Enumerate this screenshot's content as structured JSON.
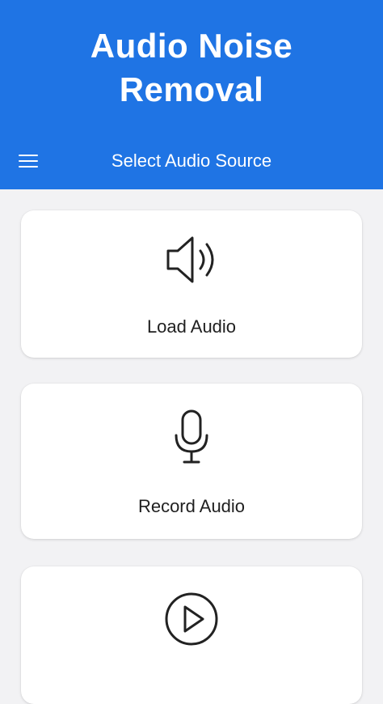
{
  "header": {
    "title": "Audio Noise\nRemoval",
    "toolbar_title": "Select Audio Source",
    "menu_icon": "hamburger-menu-icon",
    "background": "#1f74e4"
  },
  "sources": [
    {
      "label": "Load Audio",
      "icon": "speaker-icon"
    },
    {
      "label": "Record Audio",
      "icon": "microphone-icon"
    },
    {
      "label": "",
      "icon": "play-circle-icon"
    }
  ]
}
